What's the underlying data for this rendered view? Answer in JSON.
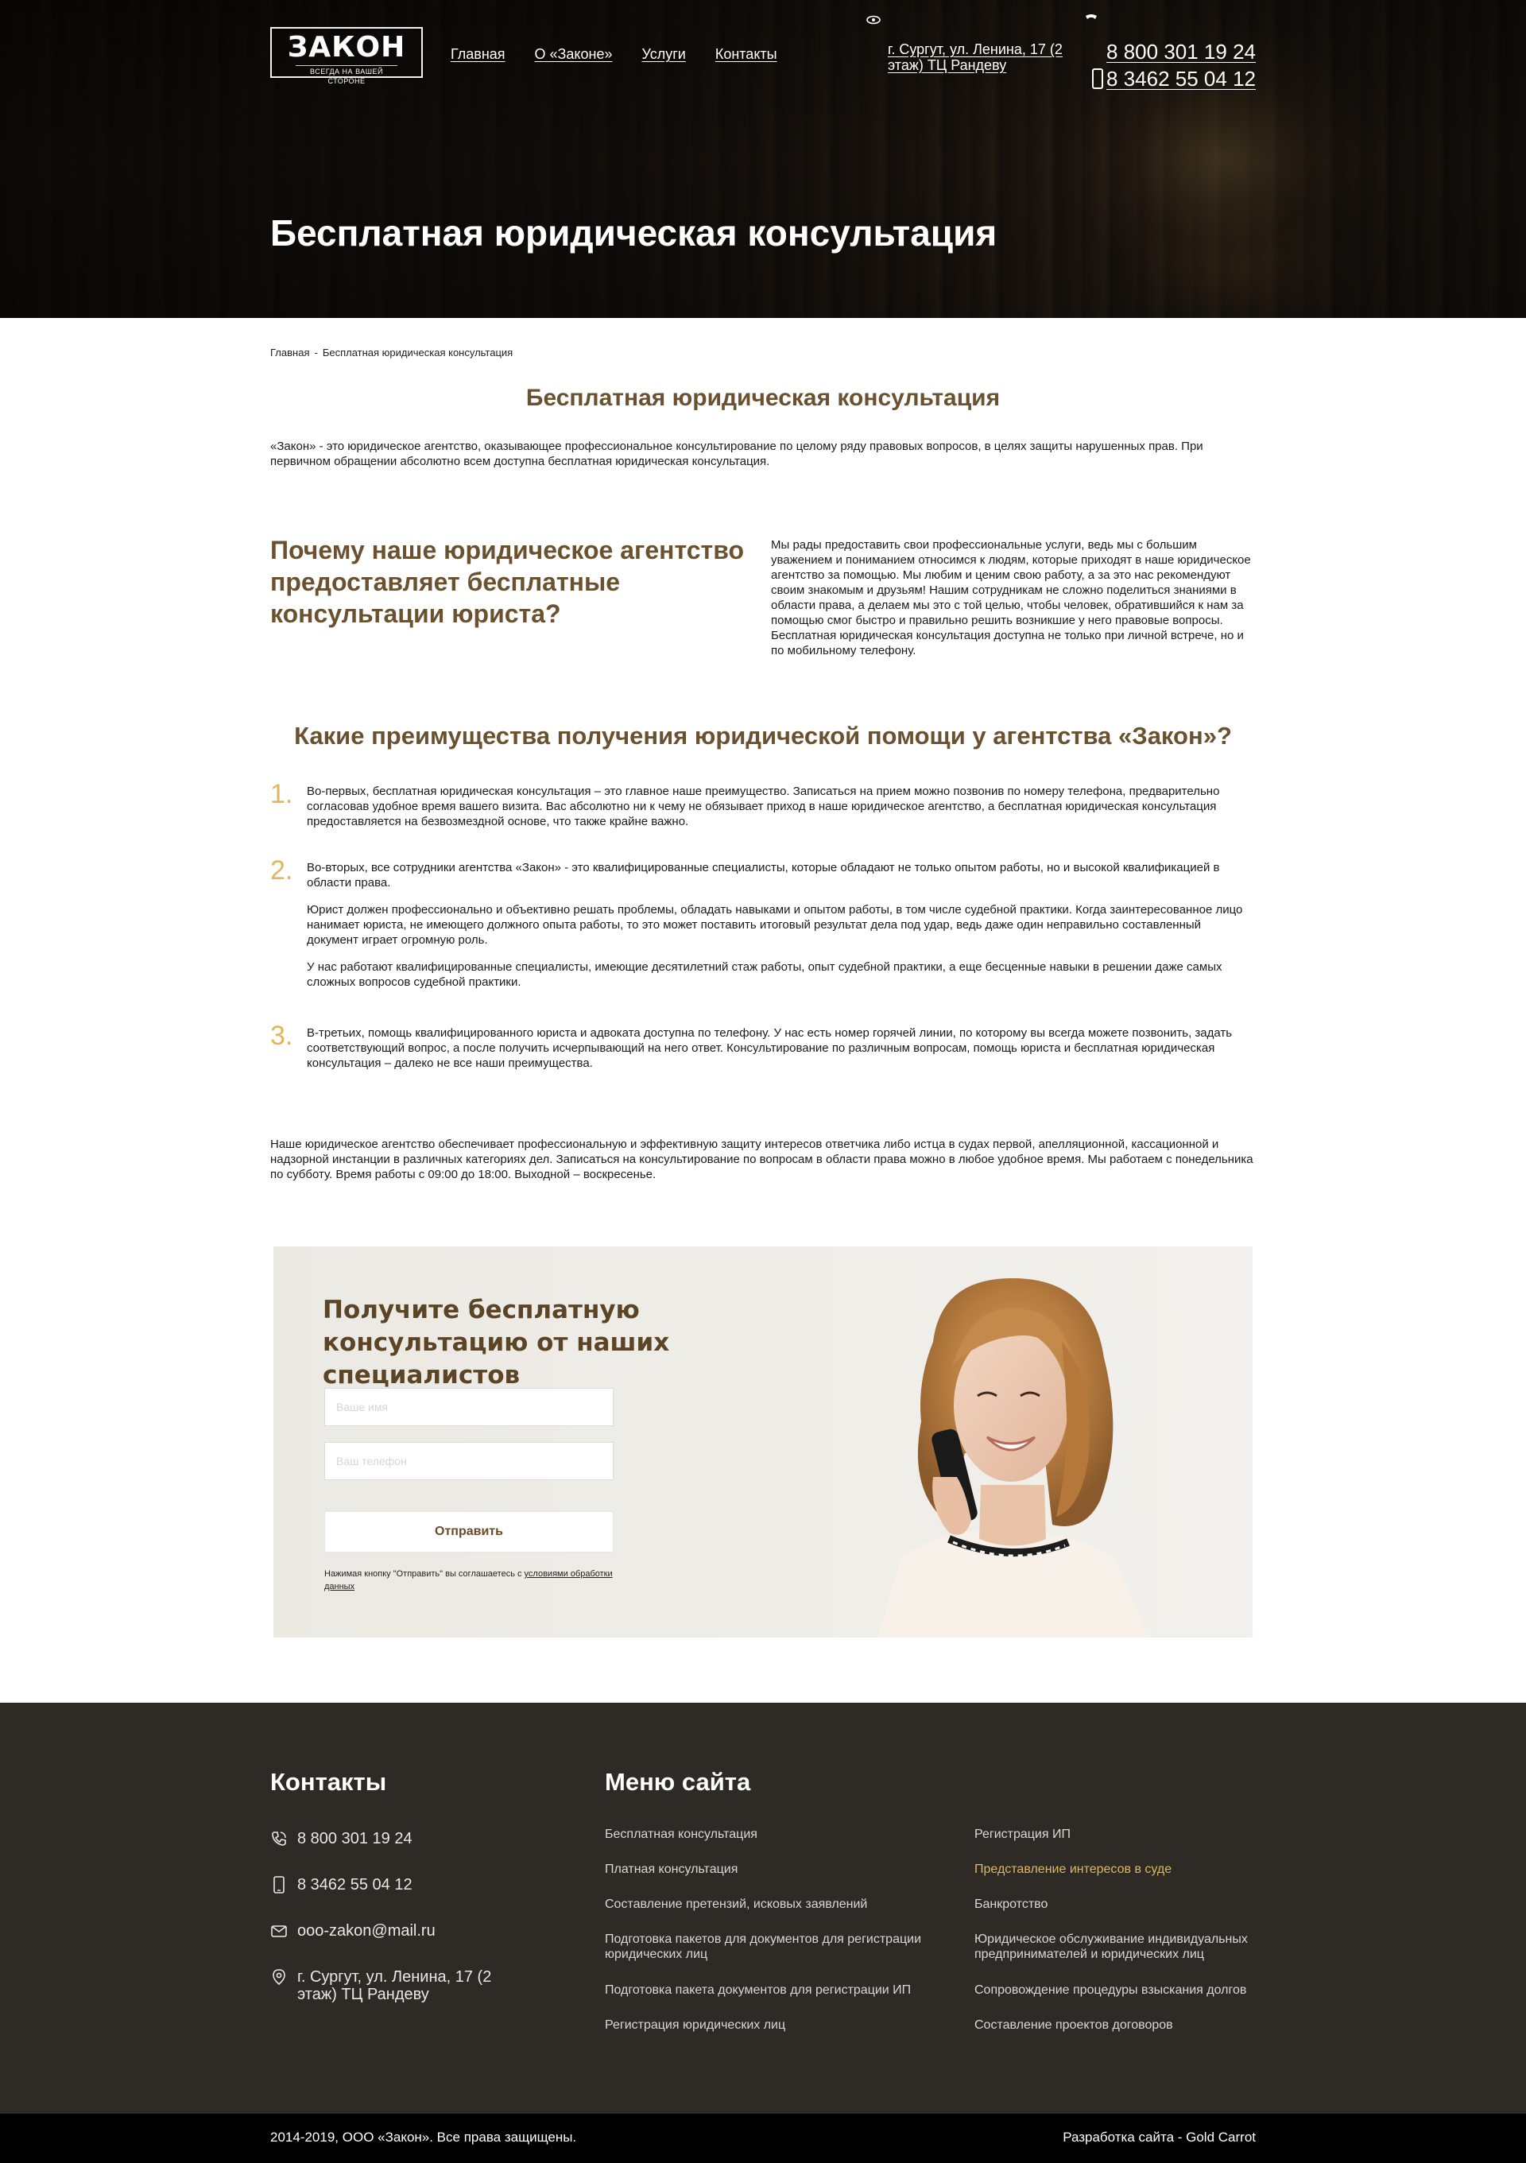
{
  "header": {
    "logo_text": "ЗАКОН",
    "logo_tagline": "ВСЕГДА НА ВАШЕЙ СТОРОНЕ",
    "nav": [
      {
        "label": "Главная"
      },
      {
        "label": "О «Законе»"
      },
      {
        "label": "Услуги"
      },
      {
        "label": "Контакты"
      }
    ],
    "address": "г. Сургут, ул. Ленина, 17 (2 этаж) ТЦ Рандеву",
    "phone_1": "8 800 301 19 24",
    "phone_2": "8 3462 55 04 12",
    "title": "Бесплатная юридическая консультация"
  },
  "breadcrumb": {
    "home": "Главная",
    "separator": "-",
    "current": "Бесплатная юридическая консультация"
  },
  "main": {
    "heading": "Бесплатная юридическая консультация",
    "intro": "«Закон» - это юридическое агентство, оказывающее профессиональное консультирование по целому ряду правовых вопросов, в целях защиты нарушенных прав. При первичном обращении абсолютно всем доступна бесплатная юридическая консультация.",
    "why_title": "Почему наше юридическое агентство предоставляет бесплатные консультации юриста?",
    "why_text": "Мы рады предоставить свои профессиональные услуги, ведь мы с большим уважением и пониманием относимся к людям, которые приходят в наше юридическое агентство за помощью. Мы любим и ценим свою работу, а за это нас рекомендуют своим знакомым и друзьям! Нашим сотрудникам не сложно поделиться знаниями в области права, а делаем мы это с той целью, чтобы человек, обратившийся к нам за помощью смог быстро и правильно решить возникшие у него правовые вопросы. Бесплатная юридическая консультация доступна не только при личной встрече, но и по мобильному телефону.",
    "advantages_title": "Какие преимущества получения юридической помощи у агентства «Закон»?",
    "advantages": [
      {
        "num": "1.",
        "p1": "Во-первых, бесплатная юридическая консультация – это главное наше преимущество. Записаться на прием можно позвонив по номеру телефона, предварительно согласовав удобное время вашего визита. Вас абсолютно ни к чему не обязывает приход в наше юридическое агентство, а бесплатная юридическая консультация предоставляется на безвозмездной основе, что также крайне важно."
      },
      {
        "num": "2.",
        "p1": "Во-вторых, все сотрудники агентства «Закон» - это квалифицированные специалисты, которые обладают не только опытом работы, но и высокой квалификацией в области права.",
        "p2": "Юрист должен профессионально и объективно решать проблемы, обладать навыками и опытом работы, в том числе судебной практики. Когда заинтересованное лицо нанимает юриста, не имеющего должного опыта работы, то это может поставить итоговый результат дела под удар, ведь даже один неправильно составленный документ играет огромную роль.",
        "p3": "У нас работают квалифицированные специалисты, имеющие десятилетний стаж работы, опыт судебной практики, а еще бесценные навыки в решении даже самых сложных вопросов судебной практики."
      },
      {
        "num": "3.",
        "p1": "В-третьих, помощь квалифицированного юриста и адвоката доступна по телефону. У нас есть номер горячей линии, по которому вы всегда можете позвонить, задать соответствующий вопрос, а после получить исчерпывающий на него ответ. Консультирование по различным вопросам, помощь юриста и бесплатная юридическая консультация – далеко не все наши преимущества."
      }
    ],
    "closing": "Наше юридическое агентство обеспечивает профессиональную и эффективную защиту интересов ответчика либо истца в судах первой, апелляционной, кассационной и надзорной инстанции в различных категориях дел. Записаться на консультирование по вопросам в области права можно в любое удобное время. Мы работаем с понедельника по субботу. Время работы с 09:00 до 18:00. Выходной – воскресенье."
  },
  "cta": {
    "title": "Получите бесплатную консультацию от наших специалистов",
    "name_placeholder": "Ваше имя",
    "phone_placeholder": "Ваш телефон",
    "submit_label": "Отправить",
    "note_prefix": "Нажимая кнопку \"Отправить\" вы соглашаетесь с ",
    "note_link": "условиями обработки данных"
  },
  "footer": {
    "contacts_title": "Контакты",
    "phone_1": "8 800 301 19 24",
    "phone_2": "8 3462 55 04 12",
    "email": "ooo-zakon@mail.ru",
    "address": "г. Сургут, ул. Ленина, 17 (2 этаж) ТЦ Рандеву",
    "menu_title": "Меню сайта",
    "menu_col1": [
      "Бесплатная консультация",
      "Платная консультация",
      "Составление претензий, исковых заявлений",
      "Подготовка пакетов для документов для регистрации юридических лиц",
      "Подготовка пакета документов для регистрации ИП",
      "Регистрация юридических лиц"
    ],
    "menu_col2": [
      "Регистрация ИП",
      "Представление интересов в суде",
      "Банкротство",
      "Юридическое обслуживание индивидуальных предпринимателей и юридических лиц",
      "Сопровождение процедуры взыскания долгов",
      "Составление проектов договоров"
    ],
    "accent_color": "#e0b75a",
    "copyright": "2014-2019, ООО «Закон». Все права защищены.",
    "developer": "Разработка сайта - Gold Carrot"
  }
}
